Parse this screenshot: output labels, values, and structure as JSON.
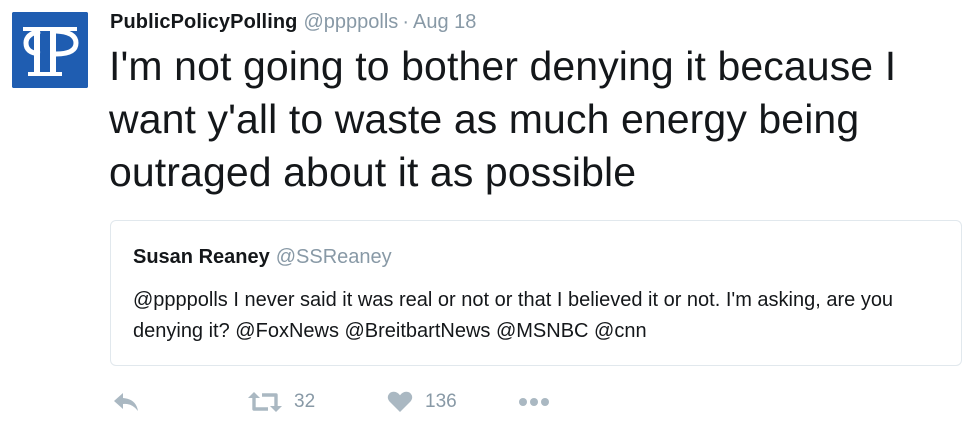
{
  "tweet": {
    "author": {
      "name": "PublicPolicyPolling",
      "handle": "@ppppolls",
      "separator": "·",
      "time": "Aug 18",
      "avatar_icon": "ppp-logo-icon",
      "avatar_color": "#1f5db1"
    },
    "text": "I'm not going to bother denying it because I want y'all to waste as much energy being outraged about it as possible",
    "quoted": {
      "name": "Susan Reaney",
      "handle": "@SSReaney",
      "text": "@ppppolls I never said it was real or not or that I believed it or not. I'm asking, are you denying it? @FoxNews @BreitbartNews @MSNBC @cnn"
    },
    "actions": {
      "reply_icon": "reply-icon",
      "retweet_icon": "retweet-icon",
      "retweet_count": "32",
      "like_icon": "heart-icon",
      "like_count": "136",
      "more_icon": "more-dots-icon"
    }
  },
  "colors": {
    "text": "#14171a",
    "muted": "#8899a6",
    "icon": "#aab8c2",
    "border": "#e1e8ed"
  }
}
